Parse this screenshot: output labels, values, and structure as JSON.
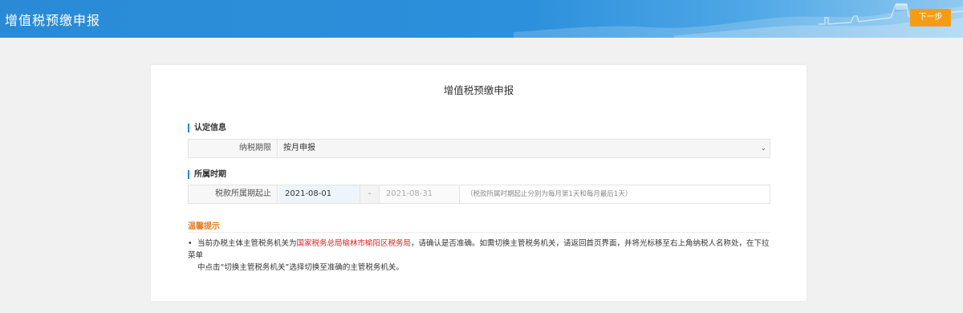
{
  "header": {
    "app_title": "增值税预缴申报",
    "next_button": "下一步"
  },
  "card": {
    "title": "增值税预缴申报",
    "section_auth": "认定信息",
    "tax_period": {
      "label": "纳税期限",
      "value": "按月申报"
    },
    "section_period": "所属时期",
    "period_range": {
      "label": "税款所属期起止",
      "start": "2021-08-01",
      "separator": "-",
      "end": "2021-08-31",
      "hint": "（税款所属时期起止分别为每月第1天和每月最后1天）"
    },
    "tips": {
      "title": "温馨提示",
      "text_before": "当前办税主体主管税务机关为",
      "highlight": "国家税务总局榆林市榆阳区税务局",
      "text_after_line1": "，请确认是否准确。如需切换主管税务机关，请返回首页界面，并将光标移至右上角纳税人名称处，在下拉菜单",
      "text_line2": "中点击“切换主管税务机关”选择切换至准确的主管税务机关。"
    }
  },
  "colors": {
    "header_blue": "#2d90dc",
    "next_orange": "#f59c16",
    "tips_orange": "#e67e22",
    "highlight_red": "#e02020",
    "section_bar": "#1e87dc"
  },
  "icons": {
    "select_chevron": "chevron-down-icon",
    "bullet": "bullet-icon"
  }
}
